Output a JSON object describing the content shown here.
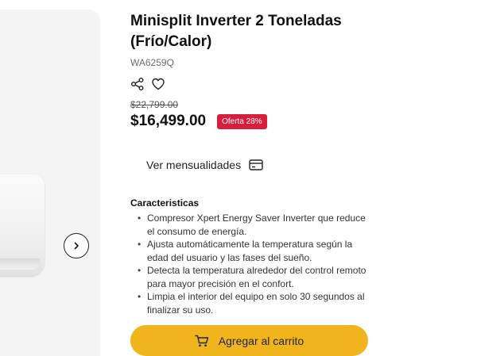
{
  "product": {
    "title_line1": "Minisplit Inverter 2 Toneladas",
    "title_line2": "(Frío/Calor)",
    "sku": "WA6259Q",
    "old_price": "$22,799.00",
    "price": "$16,499.00",
    "discount_badge": "Oferta 28%"
  },
  "installments": {
    "label": "Ver mensualidades",
    "icon": "credit-card-icon"
  },
  "features": {
    "title": "Caracteristicas",
    "items": [
      "Compresor Xpert Energy Saver Inverter que reduce el consumo de energía.",
      "Ajusta automáticamente la temperatura según la edad del usuario y las fases del sueño.",
      "Detecta la temperatura alrededor del control remoto para mayor precisión en el confort.",
      "Limpia el interior del equipo en solo 30 segundos al finalizar su uso."
    ]
  },
  "cart": {
    "label": "Agregar al carrito",
    "icon": "cart-icon"
  },
  "gallery": {
    "next_icon": "chevron-right-icon"
  },
  "actions": {
    "share_icon": "share-icon",
    "wishlist_icon": "heart-icon"
  },
  "colors": {
    "accent": "#f0b51d",
    "badge": "#d71f3c",
    "gallery_bg": "#f4f4f5"
  }
}
